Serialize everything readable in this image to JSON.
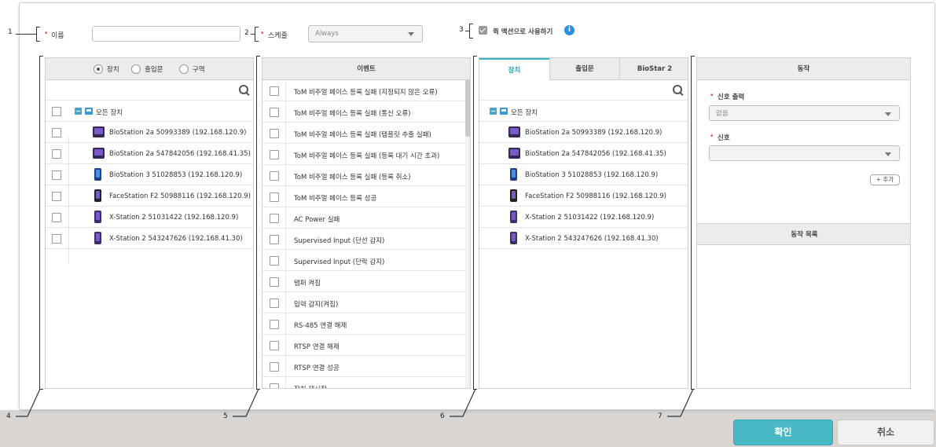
{
  "callouts": [
    "1",
    "2",
    "3",
    "4",
    "5",
    "6",
    "7"
  ],
  "form": {
    "name_label": "이름",
    "name_value": "",
    "schedule_label": "스케줄",
    "schedule_value": "Always",
    "quick_action_label": "퀵 액션으로 사용하기",
    "quick_action_checked": true,
    "info_symbol": "i"
  },
  "device_panel": {
    "radio_options": [
      "장치",
      "출입문",
      "구역"
    ],
    "radio_selected": "장치",
    "root_label": "모든 장치",
    "devices": [
      "BioStation 2a 50993389 (192.168.120.9)",
      "BioStation 2a 547842056 (192.168.41.35)",
      "BioStation 3 51028853 (192.168.120.9)",
      "FaceStation F2 50988116 (192.168.120.9)",
      "X-Station 2 51031422 (192.168.120.9)",
      "X-Station 2 543247626 (192.168.41.30)"
    ]
  },
  "event_panel": {
    "header": "이벤트",
    "events": [
      "ToM 비주얼 페이스 등록 실패 (지정되지 않은 오류)",
      "ToM 비주얼 페이스 등록 실패 (통신 오류)",
      "ToM 비주얼 페이스 등록 실패 (템플릿 추출 실패)",
      "ToM 비주얼 페이스 등록 실패 (등록 대기 시간 초과)",
      "ToM 비주얼 페이스 등록 실패 (등록 취소)",
      "ToM 비주얼 페이스 등록 성공",
      "AC Power 실패",
      "Supervised Input (단선 감지)",
      "Supervised Input (단락 감지)",
      "탬퍼 켜짐",
      "입력 감지(켜짐)",
      "RS-485 연결 해제",
      "RTSP 연결 해제",
      "RTSP 연결 성공",
      "장치 재시작"
    ]
  },
  "target_panel": {
    "tabs": [
      "장치",
      "출입문",
      "BioStar 2"
    ],
    "active_tab": "장치",
    "root_label": "모든 장치",
    "devices": [
      "BioStation 2a 50993389 (192.168.120.9)",
      "BioStation 2a 547842056 (192.168.41.35)",
      "BioStation 3 51028853 (192.168.120.9)",
      "FaceStation F2 50988116 (192.168.120.9)",
      "X-Station 2 51031422 (192.168.120.9)",
      "X-Station 2 543247626 (192.168.41.30)"
    ]
  },
  "action_panel": {
    "header": "동작",
    "signal_output_label": "신호 출력",
    "signal_output_value": "없음",
    "signal_label": "신호",
    "signal_value": "",
    "add_button": "+ 추가",
    "list_header": "동작 목록"
  },
  "buttons": {
    "confirm": "확인",
    "cancel": "취소"
  },
  "colors": {
    "accent": "#49b8c5",
    "required": "#e04a4a",
    "info": "#2d8de0",
    "footer": "#d9d5d2"
  }
}
